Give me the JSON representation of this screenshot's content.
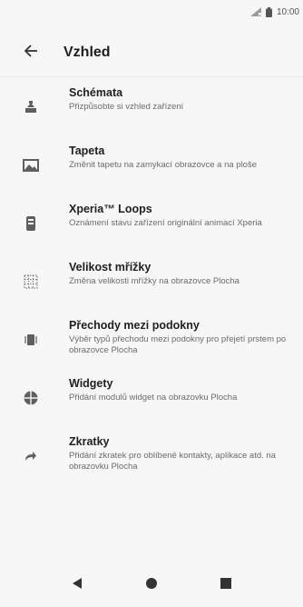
{
  "status_bar": {
    "time": "10:00",
    "icons": [
      "signal-icon",
      "battery-icon"
    ]
  },
  "header": {
    "back_icon": "arrow-back-icon",
    "title": "Vzhled"
  },
  "items": [
    {
      "title": "Schémata",
      "subtitle": "Přizpůsobte si vzhled zařízení",
      "icon": "themes-icon"
    },
    {
      "title": "Tapeta",
      "subtitle": "Změnit tapetu na zamykací obrazovce a na ploše",
      "icon": "wallpaper-icon"
    },
    {
      "title": "Xperia™ Loops",
      "subtitle": "Oznámení stavu zařízení originální animací Xperia",
      "icon": "xperia-loops-icon"
    },
    {
      "title": "Velikost mřížky",
      "subtitle": "Změna velikosti mřížky na obrazovce Plocha",
      "icon": "grid-size-icon"
    },
    {
      "title": "Přechody mezi podokny",
      "subtitle": "Výběr typů přechodu mezi podokny pro přejetí prstem po obrazovce Plocha",
      "icon": "pane-transitions-icon"
    },
    {
      "title": "Widgety",
      "subtitle": "Přidání modulů widget na obrazovku Plocha",
      "icon": "widgets-icon"
    },
    {
      "title": "Zkratky",
      "subtitle": "Přidání zkratek pro oblíbené kontakty, aplikace atd. na obrazovku Plocha",
      "icon": "shortcut-icon"
    }
  ],
  "nav_bar": {
    "icons": [
      "back-triangle-icon",
      "home-circle-icon",
      "recents-square-icon"
    ]
  },
  "colors": {
    "background": "#f7f7f7",
    "icon": "#5f5f5f"
  }
}
